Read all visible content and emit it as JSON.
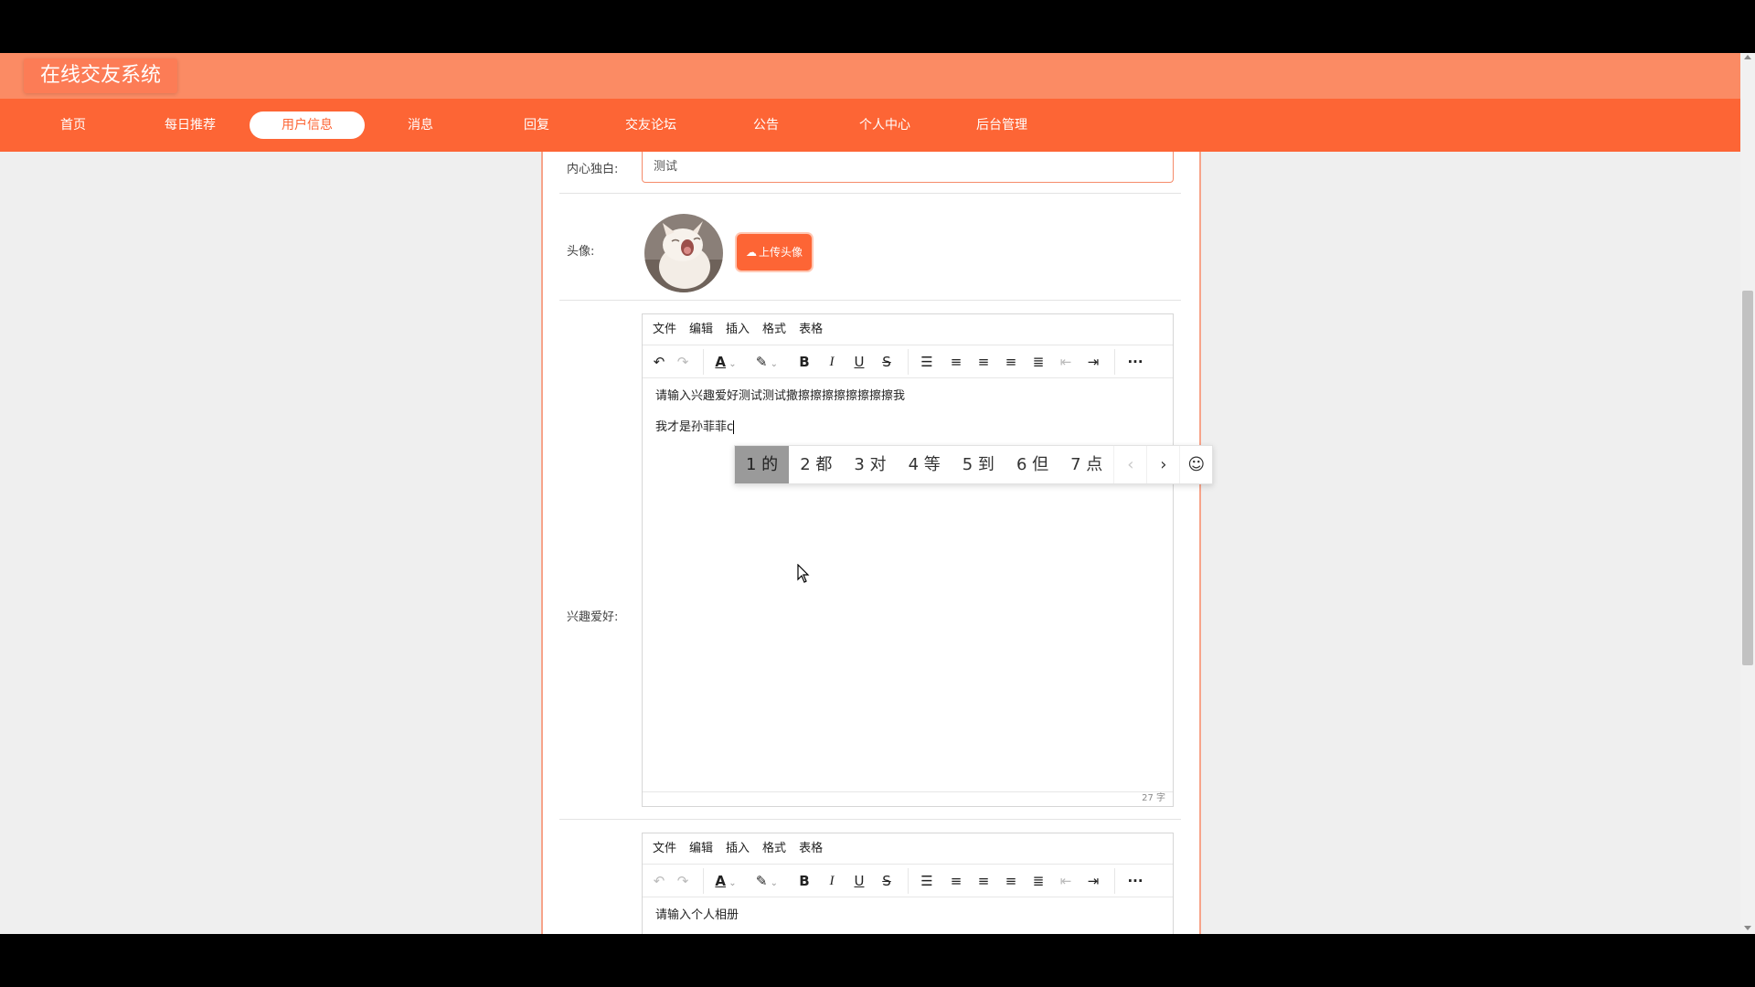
{
  "app": {
    "title": "在线交友系统"
  },
  "nav": {
    "items": [
      {
        "label": "首页"
      },
      {
        "label": "每日推荐"
      },
      {
        "label": "用户信息"
      },
      {
        "label": "消息"
      },
      {
        "label": "回复"
      },
      {
        "label": "交友论坛"
      },
      {
        "label": "公告"
      },
      {
        "label": "个人中心"
      },
      {
        "label": "后台管理"
      }
    ],
    "active": "用户信息"
  },
  "form": {
    "motto": {
      "label": "内心独白:",
      "value": "测试"
    },
    "avatar": {
      "label": "头像:",
      "upload_label": "上传头像"
    },
    "hobbies": {
      "label": "兴趣爱好:",
      "menu": [
        "文件",
        "编辑",
        "插入",
        "格式",
        "表格"
      ],
      "lines": [
        "请输入兴趣爱好测试测试撒擦擦擦擦擦擦擦擦我",
        "我才是孙菲菲c"
      ],
      "word_count": "27 字"
    },
    "album": {
      "menu": [
        "文件",
        "编辑",
        "插入",
        "格式",
        "表格"
      ],
      "lines": [
        "请输入个人相册"
      ]
    }
  },
  "toolbar_icons": [
    "undo-icon",
    "redo-icon",
    "font-color-icon",
    "highlight-icon",
    "bold-icon",
    "italic-icon",
    "underline-icon",
    "strikethrough-icon",
    "bullet-list-icon",
    "align-left-icon",
    "align-center-icon",
    "align-right-icon",
    "align-justify-icon",
    "outdent-icon",
    "indent-icon",
    "more-icon"
  ],
  "ime": {
    "candidates": [
      "1 的",
      "2 都",
      "3 对",
      "4 等",
      "5 到",
      "6 但",
      "7 点"
    ],
    "selected_index": 0
  },
  "colors": {
    "accent": "#fd6535",
    "header": "#fb8b64",
    "card_border": "#f7a48a"
  }
}
